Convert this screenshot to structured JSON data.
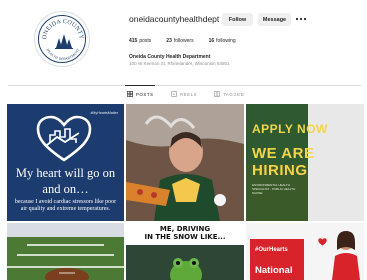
{
  "profile": {
    "username": "oneidacountyhealthdept",
    "follow_label": "Follow",
    "message_label": "Message",
    "avatar_text_top": "ONEIDA COUNTY",
    "avatar_text_bottom": "HEALTH DEPARTMENT",
    "stats": {
      "posts_count": "415",
      "posts_label": "posts",
      "followers_count": "23",
      "followers_label": "followers",
      "following_count": "16",
      "following_label": "following"
    },
    "bio_name": "Oneida County Health Department",
    "bio_address": "100 W Keenan St, Rhinelander, Wisconsin 54501"
  },
  "tabs": [
    {
      "label": "POSTS",
      "icon": "grid-icon",
      "active": true
    },
    {
      "label": "REELS",
      "icon": "reels-icon",
      "active": false
    },
    {
      "label": "TAGGED",
      "icon": "tagged-icon",
      "active": false
    }
  ],
  "posts": {
    "p1": {
      "hashtag": "#MyHeartsMatter",
      "line1": "My heart will go on",
      "line2": "and on…",
      "sub": "because I avoid cardiac stressors like poor air quality and extreme temperatures."
    },
    "p3": {
      "apply": "APPLY NOW",
      "we_are": "WE ARE",
      "hiring": "HIRING",
      "details": "ENVIRONMENTAL HEALTH SPECIALIST · PUBLIC HEALTH NURSE"
    },
    "p5": {
      "caption_line1": "ME, DRIVING",
      "caption_line2": "IN THE SNOW LIKE..."
    },
    "p6": {
      "hashtag": "#OurHearts",
      "national": "National"
    }
  },
  "colors": {
    "brand_navy": "#1f3f6e",
    "tile1_bg": "#1c3b6e",
    "hiring_yellow": "#f2d54a",
    "hearts_red": "#d8232a"
  }
}
